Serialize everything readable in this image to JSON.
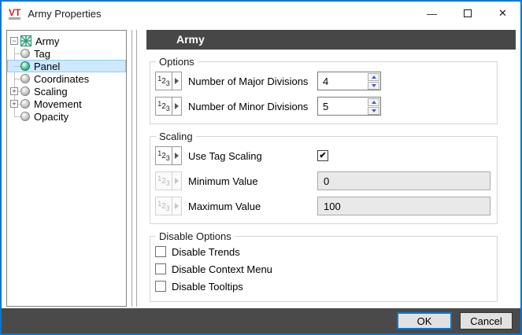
{
  "colors": {
    "accent_blue": "#0078d7",
    "header_gray": "#474747",
    "footer_gray": "#4a4a4a",
    "selection_blue": "#cde8ff",
    "army_icon_green": "#2f9e77",
    "spin_arrow_blue": "#4a5ec0"
  },
  "window": {
    "title": "Army Properties",
    "logo_text": "VT",
    "controls": {
      "minimize_glyph": "—",
      "close_glyph": "✕"
    }
  },
  "tree": {
    "root": {
      "label": "Army",
      "expander_glyph": "−",
      "expanded": true,
      "icon": "army-grid-icon"
    },
    "items": [
      {
        "label": "Tag",
        "icon": "gray-sphere",
        "selected": false
      },
      {
        "label": "Panel",
        "icon": "green-sphere",
        "selected": true
      },
      {
        "label": "Coordinates",
        "icon": "gray-sphere",
        "selected": false
      },
      {
        "label": "Scaling",
        "icon": "gray-sphere",
        "selected": false,
        "expander_glyph": "+"
      },
      {
        "label": "Movement",
        "icon": "gray-sphere",
        "selected": false,
        "expander_glyph": "+"
      },
      {
        "label": "Opacity",
        "icon": "gray-sphere",
        "selected": false
      }
    ]
  },
  "panel": {
    "header_title": "Army",
    "expr_button": {
      "digits": [
        "1",
        "2",
        "3"
      ],
      "arrow_glyph": "▸"
    },
    "options": {
      "title": "Options",
      "rows": [
        {
          "label": "Number of Major Divisions",
          "value": "4"
        },
        {
          "label": "Number of Minor Divisions",
          "value": "5"
        }
      ]
    },
    "scaling": {
      "title": "Scaling",
      "use_tag_scaling": {
        "label": "Use Tag Scaling",
        "checked": true
      },
      "minimum": {
        "label": "Minimum Value",
        "value": "0",
        "disabled": true
      },
      "maximum": {
        "label": "Maximum Value",
        "value": "100",
        "disabled": true
      }
    },
    "disable_options": {
      "title": "Disable Options",
      "items": [
        {
          "label": "Disable Trends",
          "checked": false
        },
        {
          "label": "Disable Context Menu",
          "checked": false
        },
        {
          "label": "Disable Tooltips",
          "checked": false
        }
      ]
    }
  },
  "glyphs": {
    "check": "✔"
  },
  "footer": {
    "ok_label": "OK",
    "cancel_label": "Cancel"
  }
}
